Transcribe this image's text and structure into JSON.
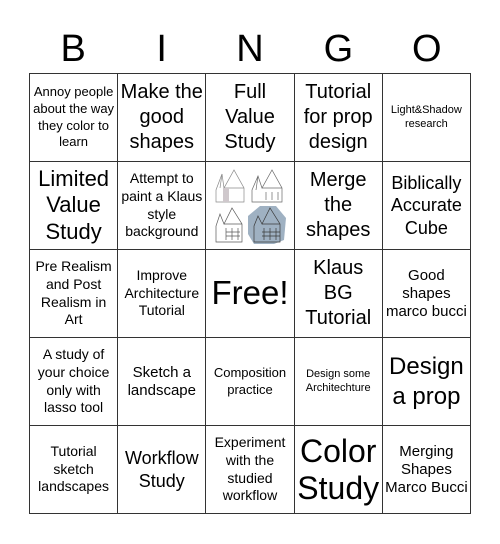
{
  "title_letters": [
    "B",
    "I",
    "N",
    "G",
    "O"
  ],
  "cells": [
    {
      "text": "Annoy people about the way they color to learn"
    },
    {
      "text": "Make the good shapes"
    },
    {
      "text": "Full Value Study"
    },
    {
      "text": "Tutorial for prop design"
    },
    {
      "text": "Light&Shadow research"
    },
    {
      "text": "Limited Value Study"
    },
    {
      "text": "Attempt to paint a Klaus style background"
    },
    {
      "image": "architecture-sketch-image"
    },
    {
      "text": "Merge the shapes"
    },
    {
      "text": "Biblically Accurate Cube"
    },
    {
      "text": "Pre Realism and Post Realism in Art"
    },
    {
      "text": "Improve Architecture Tutorial"
    },
    {
      "text": "Free!"
    },
    {
      "text": "Klaus BG Tutorial"
    },
    {
      "text": "Good shapes marco bucci"
    },
    {
      "text": "A study of your choice only with lasso tool"
    },
    {
      "text": "Sketch a landscape"
    },
    {
      "text": "Composition practice"
    },
    {
      "text": "Design some Architechture"
    },
    {
      "text": "Design a prop"
    },
    {
      "text": "Tutorial sketch landscapes"
    },
    {
      "text": "Workflow Study"
    },
    {
      "text": "Experiment with the studied workflow"
    },
    {
      "text": "Color Study"
    },
    {
      "text": "Merging Shapes Marco Bucci"
    }
  ],
  "colors": {
    "grid_line": "#333333",
    "image_highlight": "#9fb1c2"
  }
}
